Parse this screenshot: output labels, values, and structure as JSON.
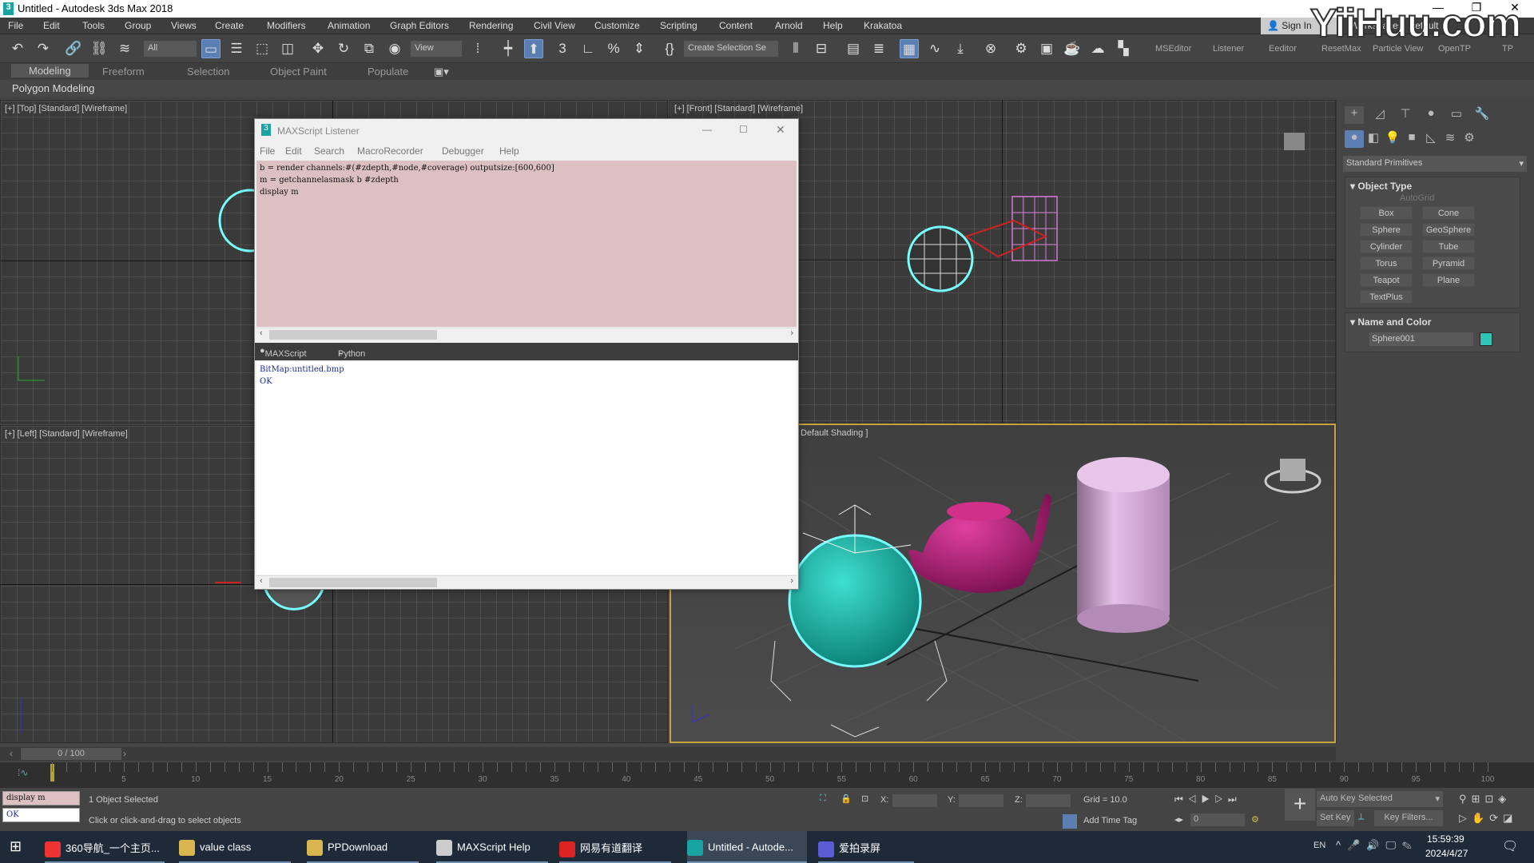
{
  "window": {
    "title": "Untitled - Autodesk 3ds Max 2018",
    "minimize": "—",
    "maximize": "❐",
    "close": "✕"
  },
  "watermark": "YiiHuu.com",
  "menu": [
    "File",
    "Edit",
    "Tools",
    "Group",
    "Views",
    "Create",
    "Modifiers",
    "Animation",
    "Graph Editors",
    "Rendering",
    "Civil View",
    "Customize",
    "Scripting",
    "Content",
    "Arnold",
    "Help",
    "Krakatoa"
  ],
  "account": {
    "sign_in": "Sign In",
    "workspace": "Workspaces: Default"
  },
  "toolbar": {
    "selection_filter": "All",
    "reference_coord": "View",
    "named_selection": "Create Selection Se",
    "custom_buttons": [
      "MSEditor",
      "Listener",
      "Eeditor",
      "ResetMax",
      "Particle View",
      "OpenTP",
      "TP"
    ]
  },
  "ribbon": {
    "tabs": [
      "Modeling",
      "Freeform",
      "Selection",
      "Object Paint",
      "Populate"
    ],
    "active": "Modeling",
    "panel": "Polygon Modeling"
  },
  "viewports": {
    "top": "[+] [Top] [Standard] [Wireframe]",
    "front": "[+] [Front] [Standard] [Wireframe]",
    "left": "[+] [Left] [Standard] [Wireframe]",
    "perspective": "Default Shading ]"
  },
  "listener": {
    "title": "MAXScript Listener",
    "menu": [
      "File",
      "Edit",
      "Search",
      "MacroRecorder",
      "Debugger",
      "Help"
    ],
    "input": "b = render channels:#(#zdepth,#node,#coverage) outputsize:[600,600]\nm = getchannelasmask b #zdepth\ndisplay m",
    "tabs": [
      "MAXScript",
      "Python"
    ],
    "output": "BitMap:untitled.bmp\nOK"
  },
  "command_panel": {
    "category": "Standard Primitives",
    "object_type": "Object Type",
    "autogrid": "AutoGrid",
    "buttons": [
      "Box",
      "Cone",
      "Sphere",
      "GeoSphere",
      "Cylinder",
      "Tube",
      "Torus",
      "Pyramid",
      "Teapot",
      "Plane",
      "TextPlus"
    ],
    "name_and_color": "Name and Color",
    "object_name": "Sphere001",
    "object_color": "#2ec4b6"
  },
  "timeline": {
    "frame": "0 / 100",
    "current": 0,
    "end": 100
  },
  "status": {
    "mini_input": "display m",
    "mini_output": "OK",
    "selection": "1 Object Selected",
    "prompt": "Click or click-and-drag to select objects",
    "x_label": "X:",
    "y_label": "Y:",
    "z_label": "Z:",
    "grid": "Grid = 10.0",
    "add_time_tag": "Add Time Tag",
    "auto_key": "Auto Key",
    "key_mode": "Selected",
    "set_key": "Set Key",
    "key_filters": "Key Filters...",
    "frame_value": "0"
  },
  "taskbar": {
    "items": [
      "360导航_一个主页...",
      "value class",
      "PPDownload",
      "MAXScript Help",
      "网易有道翻译",
      "Untitled - Autode...",
      "爱拍录屏"
    ],
    "lang": "EN",
    "time": "15:59:39",
    "date": "2024/4/27"
  },
  "colors": {
    "sphere": "#2ec4b6",
    "teapot": "#c2247e",
    "cylinder": "#d6a6d8",
    "selection_border": "#c9a33c"
  }
}
